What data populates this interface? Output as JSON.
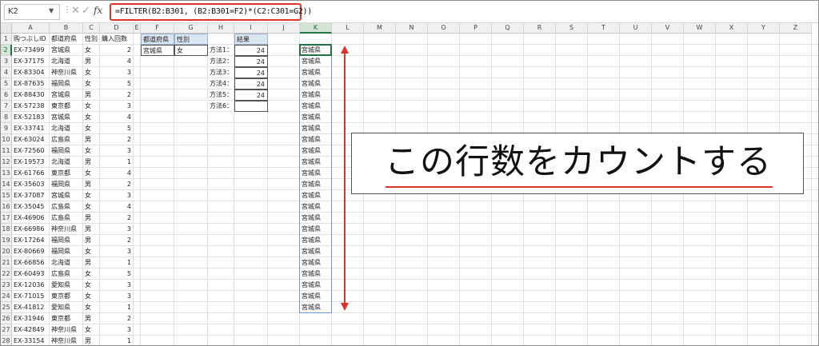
{
  "formula_bar": {
    "name_box": "K2",
    "formula": "=FILTER(B2:B301, (B2:B301=F2)*(C2:C301=G2))"
  },
  "columns": [
    "A",
    "B",
    "C",
    "D",
    "E",
    "F",
    "G",
    "H",
    "I",
    "J",
    "K",
    "L",
    "M",
    "N",
    "O",
    "P",
    "Q",
    "R",
    "S",
    "T",
    "U",
    "V",
    "W",
    "X",
    "Y",
    "Z"
  ],
  "rows": [
    "1",
    "2",
    "3",
    "4",
    "5",
    "6",
    "7",
    "8",
    "9",
    "10",
    "11",
    "12",
    "13",
    "14",
    "15",
    "16",
    "17",
    "18",
    "19",
    "20",
    "21",
    "22",
    "23",
    "24",
    "25",
    "26",
    "27",
    "28"
  ],
  "table_headers": [
    "购つぶしID",
    "都道府県",
    "性別",
    "購入回数"
  ],
  "table_rows": [
    [
      "EX-73499",
      "宮城県",
      "女",
      "2"
    ],
    [
      "EX-37175",
      "北海道",
      "男",
      "4"
    ],
    [
      "EX-83304",
      "神奈川県",
      "女",
      "3"
    ],
    [
      "EX-87635",
      "福岡県",
      "女",
      "5"
    ],
    [
      "EX-88430",
      "宮城県",
      "男",
      "2"
    ],
    [
      "EX-57238",
      "東京都",
      "女",
      "3"
    ],
    [
      "EX-52183",
      "宮城県",
      "女",
      "4"
    ],
    [
      "EX-33741",
      "北海道",
      "女",
      "5"
    ],
    [
      "EX-63024",
      "広島県",
      "男",
      "2"
    ],
    [
      "EX-72560",
      "福岡県",
      "女",
      "3"
    ],
    [
      "EX-19573",
      "北海道",
      "男",
      "1"
    ],
    [
      "EX-61766",
      "東京都",
      "女",
      "4"
    ],
    [
      "EX-35603",
      "福岡県",
      "男",
      "2"
    ],
    [
      "EX-37087",
      "宮城県",
      "女",
      "3"
    ],
    [
      "EX-35045",
      "広島県",
      "女",
      "4"
    ],
    [
      "EX-46906",
      "広島県",
      "男",
      "2"
    ],
    [
      "EX-66986",
      "神奈川県",
      "男",
      "3"
    ],
    [
      "EX-17264",
      "福岡県",
      "男",
      "2"
    ],
    [
      "EX-80669",
      "福岡県",
      "女",
      "3"
    ],
    [
      "EX-66856",
      "北海道",
      "男",
      "1"
    ],
    [
      "EX-60493",
      "広島県",
      "女",
      "5"
    ],
    [
      "EX-12036",
      "愛知県",
      "女",
      "3"
    ],
    [
      "EX-71015",
      "東京都",
      "女",
      "3"
    ],
    [
      "EX-41812",
      "愛知県",
      "女",
      "1"
    ],
    [
      "EX-31946",
      "東京都",
      "男",
      "2"
    ],
    [
      "EX-42849",
      "神奈川県",
      "女",
      "3"
    ],
    [
      "EX-33154",
      "神奈川県",
      "男",
      "1"
    ]
  ],
  "criteria": {
    "headers": [
      "都道府県",
      "性別"
    ],
    "values": [
      "宮城県",
      "女"
    ]
  },
  "results": {
    "header": "結果",
    "labels": [
      "方法1：",
      "方法2：",
      "方法3：",
      "方法4：",
      "方法5：",
      "方法6："
    ],
    "values": [
      "24",
      "24",
      "24",
      "24",
      "24",
      ""
    ]
  },
  "spill_values": [
    "宮城県",
    "宮城県",
    "宮城県",
    "宮城県",
    "宮城県",
    "宮城県",
    "宮城県",
    "宮城県",
    "宮城県",
    "宮城県",
    "宮城県",
    "宮城県",
    "宮城県",
    "宮城県",
    "宮城県",
    "宮城県",
    "宮城県",
    "宮城県",
    "宮城県",
    "宮城県",
    "宮城県",
    "宮城県",
    "宮城県",
    "宮城県"
  ],
  "annotation": {
    "text": "この行数をカウントする"
  },
  "colors": {
    "accent_red": "#e0322b",
    "excel_green": "#217346",
    "header_fill": "#dbe6f3"
  }
}
